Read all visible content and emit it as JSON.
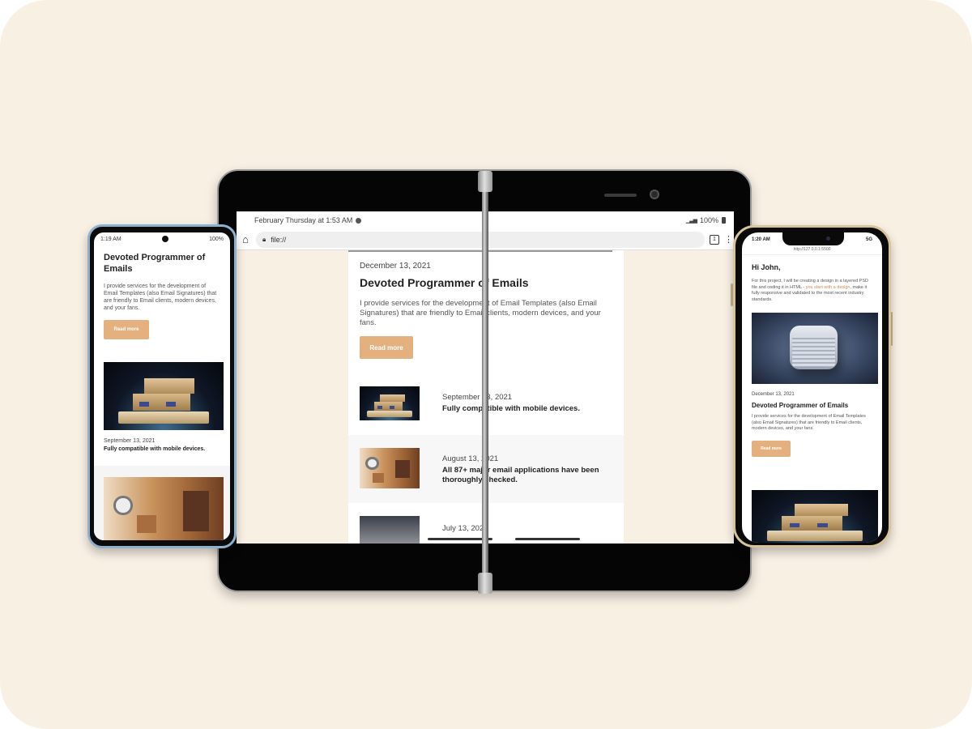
{
  "tablet": {
    "status": {
      "datetime": "February Thursday at 1:53 AM",
      "battery": "100%"
    },
    "browser": {
      "url": "file://",
      "tabs_count": "1"
    },
    "hero": {
      "date": "December 13, 2021",
      "title": "Devoted Programmer of Emails",
      "text": "I provide services for the development of Email Templates (also Email Signatures) that are friendly to Email clients, modern devices, and your fans.",
      "button": "Read more"
    },
    "posts": [
      {
        "date": "September 13, 2021",
        "title": "Fully compatible with mobile devices."
      },
      {
        "date": "August 13, 2021",
        "title": "All 87+ major email applications have been thoroughly checked."
      },
      {
        "date": "July 13, 2021",
        "title": ""
      }
    ]
  },
  "phone_left": {
    "status": {
      "time": "1:19 AM",
      "battery": "100%"
    },
    "hero": {
      "title": "Devoted Programmer of Emails",
      "text": "I provide services for the development of Email Templates (also Email Signatures) that are friendly to Email clients, modern devices, and your fans.",
      "button": "Read more"
    },
    "post": {
      "date": "September 13, 2021",
      "title": "Fully compatible with mobile devices."
    }
  },
  "phone_right": {
    "status": {
      "time": "1:20 AM",
      "network": "5G"
    },
    "url": "http://127.0.0.1:5500",
    "greeting": "Hi John,",
    "intro": "For this project, I will be creating a design in a layered PSD file and coding it in HTML -",
    "intro_link": "you start with a design",
    "intro_end": ", make it fully responsive and validated to the most recent industry standards.",
    "date": "December 13, 2021",
    "title": "Devoted Programmer of Emails",
    "text": "I provide services for the development of Email Templates (also Email Signatures) that are friendly to Email clients, modern devices, and your fans.",
    "button": "Read more"
  },
  "colors": {
    "background": "#f9f0e4",
    "accent_button": "#e4b07e",
    "link": "#c98b4f"
  }
}
